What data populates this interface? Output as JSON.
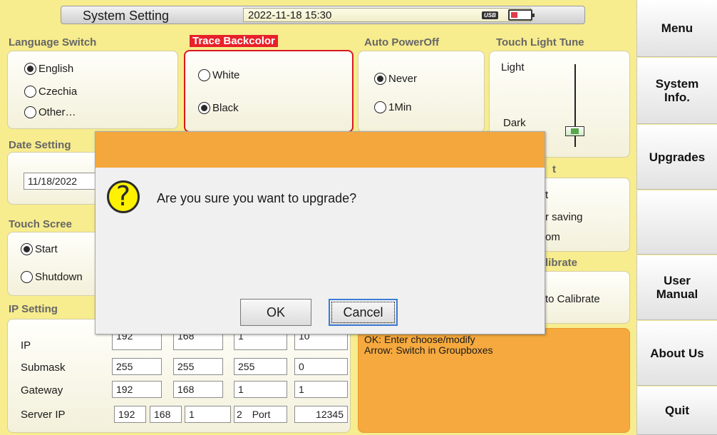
{
  "status": {
    "title": "System Setting",
    "datetime": "2022-11-18 15:30",
    "usb": "USB"
  },
  "language": {
    "header": "Language Switch",
    "options": [
      {
        "label": "English",
        "on": true
      },
      {
        "label": "Czechia",
        "on": false
      },
      {
        "label": "Other…",
        "on": false
      }
    ]
  },
  "trace": {
    "header": "Trace Backcolor",
    "options": [
      {
        "label": "White",
        "on": false
      },
      {
        "label": "Black",
        "on": true
      }
    ]
  },
  "auto_power": {
    "header": "Auto PowerOff",
    "options": [
      {
        "label": "Never",
        "on": true
      },
      {
        "label": "1Min",
        "on": false
      }
    ]
  },
  "touch_light": {
    "header": "Touch Light Tune",
    "top_label": "Light",
    "bottom_label": "Dark",
    "level": 0.2
  },
  "date": {
    "header": "Date Setting",
    "value": "11/18/2022"
  },
  "touch_screen": {
    "header": "Touch Scree",
    "options": [
      {
        "label": "Start",
        "on": true
      },
      {
        "label": "Shutdown",
        "on": false
      }
    ]
  },
  "right_partial": {
    "header1": "t",
    "line1": "t",
    "line2": "r saving",
    "line3": "om",
    "header2": "librate",
    "calibrate": "to Calibrate"
  },
  "ip": {
    "header": "IP Setting",
    "labels": {
      "ip": "IP",
      "submask": "Submask",
      "gateway": "Gateway",
      "server": "Server IP",
      "port": "Port"
    },
    "ip": [
      "192",
      "168",
      "1",
      "10"
    ],
    "submask": [
      "255",
      "255",
      "255",
      "0"
    ],
    "gateway": [
      "192",
      "168",
      "1",
      "1"
    ],
    "server": [
      "192",
      "168",
      "1",
      "2"
    ],
    "port": "12345"
  },
  "help": {
    "line1": "OK: Enter choose/modify",
    "line2": "Arrow: Switch in Groupboxes"
  },
  "menu": [
    "Menu",
    "System\nInfo.",
    "Upgrades",
    "",
    "User\nManual",
    "About Us",
    "Quit"
  ],
  "dialog": {
    "message": "Are you sure you want to upgrade?",
    "ok": "OK",
    "cancel": "Cancel"
  }
}
